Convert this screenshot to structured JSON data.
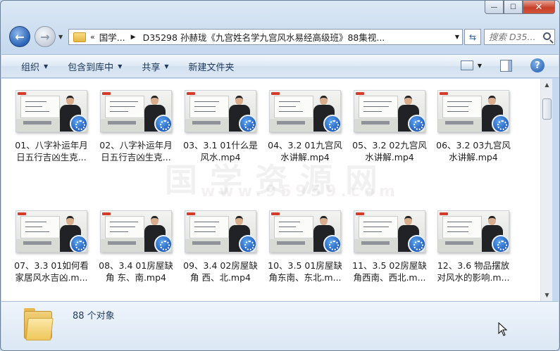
{
  "window": {
    "controls": {
      "minimize": "—",
      "maximize": "☐",
      "close": "✕"
    }
  },
  "address": {
    "chevron": "«",
    "segment": "国学...",
    "separator": "▶",
    "path": "D35298 孙赫珑《九宫姓名学九宫风水易经高级班》88集视...",
    "search_placeholder": "搜索 D35..."
  },
  "toolbar": {
    "organize": "组织",
    "include_library": "包含到库中",
    "share": "共享",
    "new_folder": "新建文件夹"
  },
  "files": [
    {
      "name": "01、八字补运年月日五行吉凶生克..."
    },
    {
      "name": "02、八字补运年月日五行吉凶生克..."
    },
    {
      "name": "03、3.1 01什么是风水.mp4"
    },
    {
      "name": "04、3.2 01九宫风水讲解.mp4"
    },
    {
      "name": "05、3.2 02九宫风水讲解.mp4"
    },
    {
      "name": "06、3.2 03九宫风水讲解.mp4"
    },
    {
      "name": "07、3.3 01如何看家居风水吉凶.m..."
    },
    {
      "name": "08、3.4 01房屋缺角 东、南.mp4"
    },
    {
      "name": "09、3.4 02房屋缺角 西、北.mp4"
    },
    {
      "name": "10、3.5 01房屋缺角东南、东北.m..."
    },
    {
      "name": "11、3.5 02房屋缺角西南、西北.m..."
    },
    {
      "name": "12、3.6 物品摆放对风水的影响.m..."
    }
  ],
  "watermark": {
    "line1": "国学资源网",
    "line2": "www.95959.com"
  },
  "status": {
    "count": "88 个对象"
  },
  "icons": {
    "media": "media-player-icon",
    "folder": "folder-icon",
    "help": "?"
  }
}
